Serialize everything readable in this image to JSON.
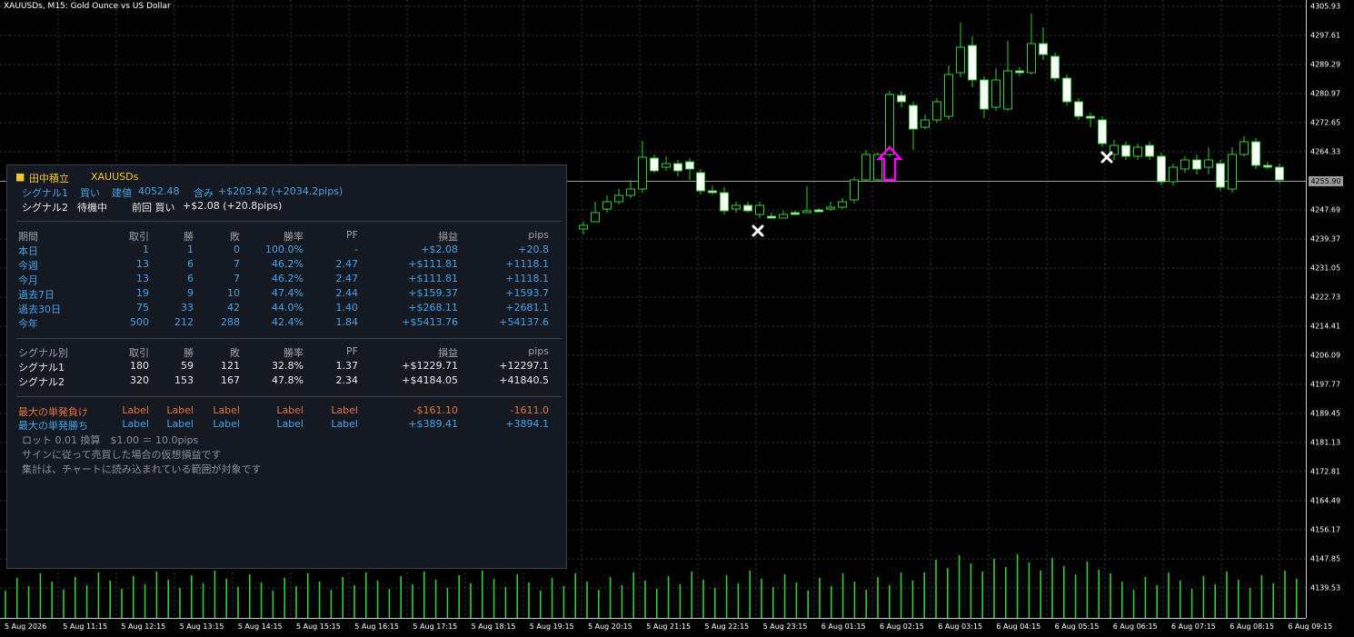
{
  "chart": {
    "title": "XAUUSDs, M15:  Gold Ounce vs US Dollar",
    "current_price": "4255.90",
    "price_ticks": [
      "4305.93",
      "4297.61",
      "4289.29",
      "4280.97",
      "4272.65",
      "4264.33",
      "4247.69",
      "4239.37",
      "4231.05",
      "4222.73",
      "4214.41",
      "4206.09",
      "4197.77",
      "4189.45",
      "4181.13",
      "4172.81",
      "4164.49",
      "4156.17",
      "4147.85",
      "4139.53"
    ],
    "time_ticks": [
      "5 Aug 2026",
      "5 Aug 11:15",
      "5 Aug 12:15",
      "5 Aug 13:15",
      "5 Aug 14:15",
      "5 Aug 15:15",
      "5 Aug 16:15",
      "5 Aug 17:15",
      "5 Aug 18:15",
      "5 Aug 19:15",
      "5 Aug 20:15",
      "5 Aug 21:15",
      "5 Aug 22:15",
      "5 Aug 23:15",
      "6 Aug 01:15",
      "6 Aug 02:15",
      "6 Aug 03:15",
      "6 Aug 04:15",
      "6 Aug 05:15",
      "6 Aug 06:15",
      "6 Aug 07:15",
      "6 Aug 08:15",
      "6 Aug 09:15"
    ],
    "colors": {
      "bull": "#32cd32",
      "bear_body": "#ffffff",
      "grid": "#3a3a3a",
      "signal_arrow": "#ff00ff"
    }
  },
  "panel": {
    "title": "田中積立",
    "symbol": "XAUUSDs",
    "signal1": {
      "name": "シグナル1",
      "side": "買い",
      "label": "建値",
      "entry": "4052.48",
      "unreal_label": "含み",
      "unreal": "+$203.42  (+2034.2pips)"
    },
    "signal2": {
      "name": "シグナル2",
      "status": "待機中",
      "last_label": "前回 買い",
      "last": "+$2.08  (+20.8pips)"
    },
    "period_headers": [
      "期間",
      "取引",
      "勝",
      "敗",
      "勝率",
      "PF",
      "損益",
      "pips"
    ],
    "period_rows": [
      [
        "本日",
        "1",
        "1",
        "0",
        "100.0%",
        "-",
        "+$2.08",
        "+20.8"
      ],
      [
        "今週",
        "13",
        "6",
        "7",
        "46.2%",
        "2.47",
        "+$111.81",
        "+1118.1"
      ],
      [
        "今月",
        "13",
        "6",
        "7",
        "46.2%",
        "2.47",
        "+$111.81",
        "+1118.1"
      ],
      [
        "過去7日",
        "19",
        "9",
        "10",
        "47.4%",
        "2.44",
        "+$159.37",
        "+1593.7"
      ],
      [
        "過去30日",
        "75",
        "33",
        "42",
        "44.0%",
        "1.40",
        "+$268.11",
        "+2681.1"
      ],
      [
        "今年",
        "500",
        "212",
        "288",
        "42.4%",
        "1.84",
        "+$5413.76",
        "+54137.6"
      ]
    ],
    "signal_headers": [
      "シグナル別",
      "取引",
      "勝",
      "敗",
      "勝率",
      "PF",
      "損益",
      "pips"
    ],
    "signal_rows": [
      [
        "シグナル1",
        "180",
        "59",
        "121",
        "32.8%",
        "1.37",
        "+$1229.71",
        "+12297.1"
      ],
      [
        "シグナル2",
        "320",
        "153",
        "167",
        "47.8%",
        "2.34",
        "+$4184.05",
        "+41840.5"
      ]
    ],
    "max_loss": [
      "最大の単発負け",
      "Label",
      "Label",
      "Label",
      "Label",
      "Label",
      "-$161.10",
      "-1611.0"
    ],
    "max_win": [
      "最大の単発勝ち",
      "Label",
      "Label",
      "Label",
      "Label",
      "Label",
      "+$389.41",
      "+3894.1"
    ],
    "notes": [
      "ロット 0.01 換算　$1.00 ＝ 10.0pips",
      "サインに従って売買した場合の仮想損益です",
      "集計は、チャートに読み込まれている範囲が対象です"
    ]
  }
}
